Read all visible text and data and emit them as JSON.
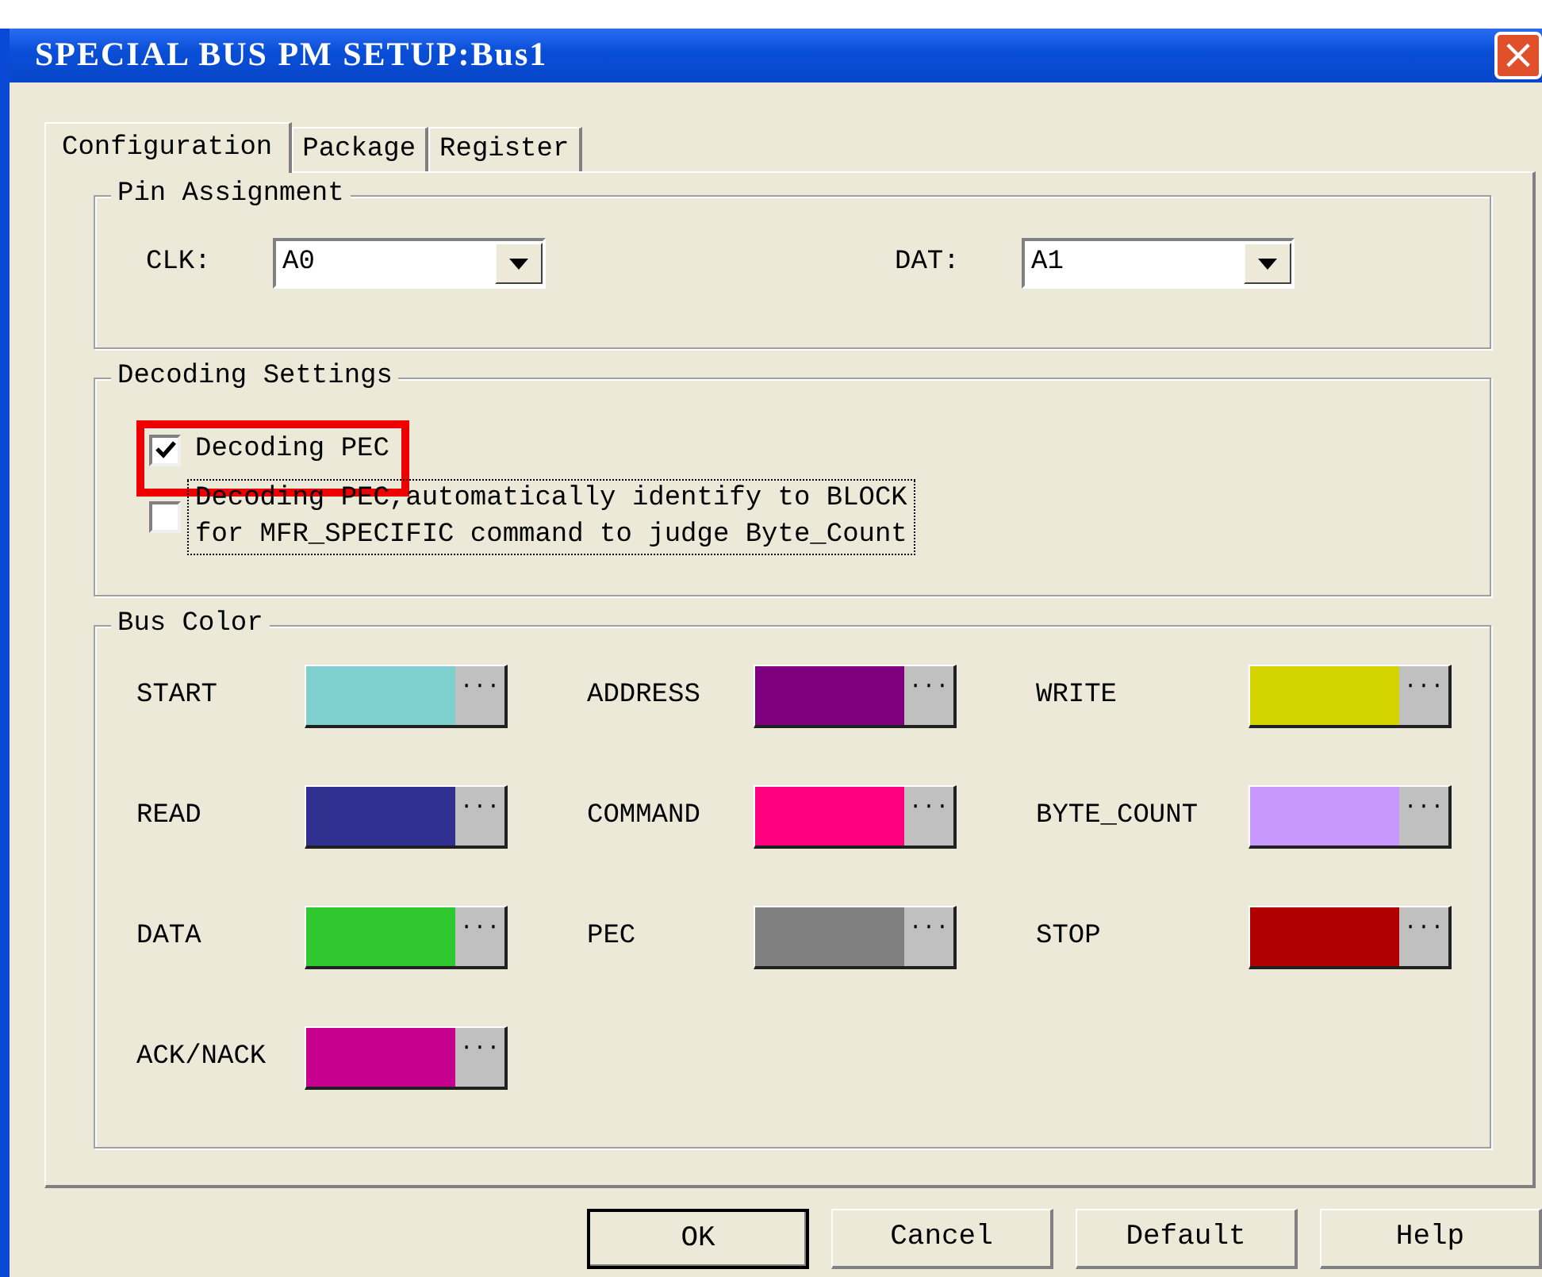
{
  "window": {
    "title": "SPECIAL BUS PM SETUP:Bus1",
    "close": "×"
  },
  "tabs": [
    {
      "label": "Configuration",
      "selected": true
    },
    {
      "label": "Package",
      "selected": false
    },
    {
      "label": "Register",
      "selected": false
    }
  ],
  "pin_assignment": {
    "title": "Pin Assignment",
    "fields": [
      {
        "label": "CLK:",
        "value": "A0"
      },
      {
        "label": "DAT:",
        "value": "A1"
      }
    ]
  },
  "decoding_settings": {
    "title": "Decoding Settings",
    "options": [
      {
        "label": "Decoding PEC",
        "checked": true,
        "highlighted": true,
        "focused": false
      },
      {
        "label": "Decoding PEC,automatically identify to BLOCK\nfor MFR_SPECIFIC command to judge Byte_Count",
        "checked": false,
        "highlighted": false,
        "focused": true
      }
    ]
  },
  "bus_color": {
    "title": "Bus Color",
    "items": [
      {
        "label": "START",
        "color": "#80cfcf",
        "button": "···"
      },
      {
        "label": "ADDRESS",
        "color": "#7f007f",
        "button": "···"
      },
      {
        "label": "WRITE",
        "color": "#d4d400",
        "button": "···"
      },
      {
        "label": "READ",
        "color": "#303090",
        "button": "···"
      },
      {
        "label": "COMMAND",
        "color": "#ff0080",
        "button": "···"
      },
      {
        "label": "BYTE_COUNT",
        "color": "#c898ff",
        "button": "···"
      },
      {
        "label": "DATA",
        "color": "#30c830",
        "button": "···"
      },
      {
        "label": "PEC",
        "color": "#808080",
        "button": "···"
      },
      {
        "label": "STOP",
        "color": "#b00000",
        "button": "···"
      },
      {
        "label": "ACK/NACK",
        "color": "#c80090",
        "button": "···"
      }
    ]
  },
  "buttons": [
    {
      "label": "OK",
      "default": true
    },
    {
      "label": "Cancel",
      "default": false
    },
    {
      "label": "Default",
      "default": false
    },
    {
      "label": "Help",
      "default": false
    }
  ]
}
